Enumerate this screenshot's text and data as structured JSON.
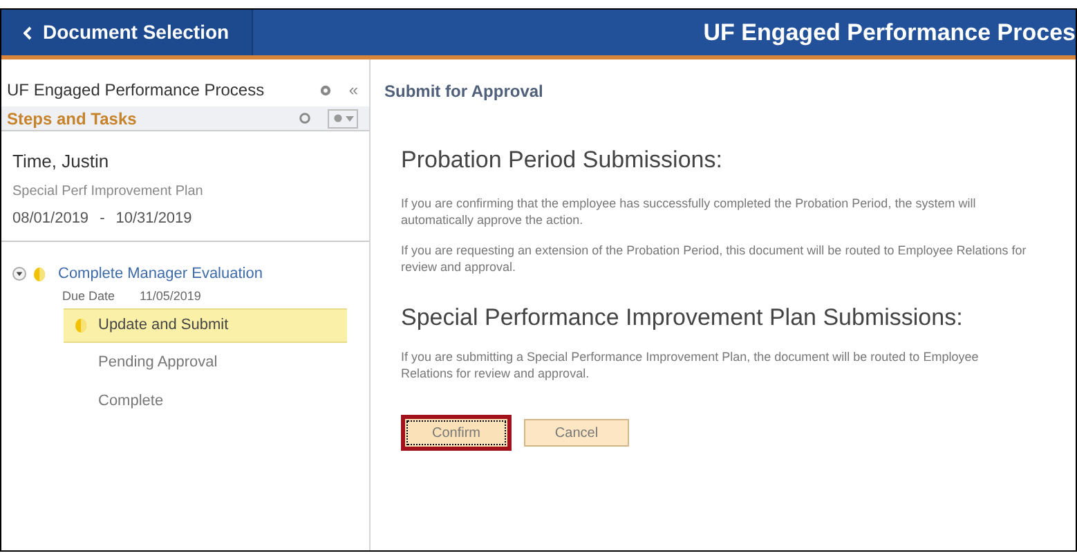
{
  "header": {
    "back_button": "Document Selection",
    "title": "UF Engaged Performance Proces"
  },
  "sidebar": {
    "title": "UF Engaged Performance Process",
    "collapse_glyph": "«",
    "section": "Steps and Tasks",
    "employee": {
      "name": "Time, Justin",
      "plan": "Special Perf Improvement Plan",
      "start": "08/01/2019",
      "separator": "-",
      "end": "10/31/2019"
    },
    "tasks": [
      {
        "label": "Complete Manager Evaluation",
        "expanded": true,
        "in_progress": true,
        "due_label": "Due Date",
        "due_date": "11/05/2019",
        "children": [
          {
            "label": "Update and Submit",
            "selected": true,
            "in_progress": true
          },
          {
            "label": "Pending Approval",
            "selected": false,
            "in_progress": false
          },
          {
            "label": "Complete",
            "selected": false,
            "in_progress": false
          }
        ]
      }
    ]
  },
  "main": {
    "title": "Submit for Approval",
    "sections": [
      {
        "heading": "Probation Period Submissions:",
        "paragraphs": [
          "If you are confirming that the employee has successfully completed the Probation Period, the system will automatically approve the action.",
          "If you are requesting an extension of the Probation Period, this document will be routed to Employee Relations for review and approval."
        ]
      },
      {
        "heading": "Special Performance Improvement Plan Submissions:",
        "paragraphs": [
          "If you are submitting a Special Performance Improvement Plan, the document will be routed to Employee Relations for review and approval."
        ]
      }
    ],
    "buttons": [
      {
        "label": "Confirm",
        "highlighted": true
      },
      {
        "label": "Cancel",
        "highlighted": false
      }
    ]
  }
}
